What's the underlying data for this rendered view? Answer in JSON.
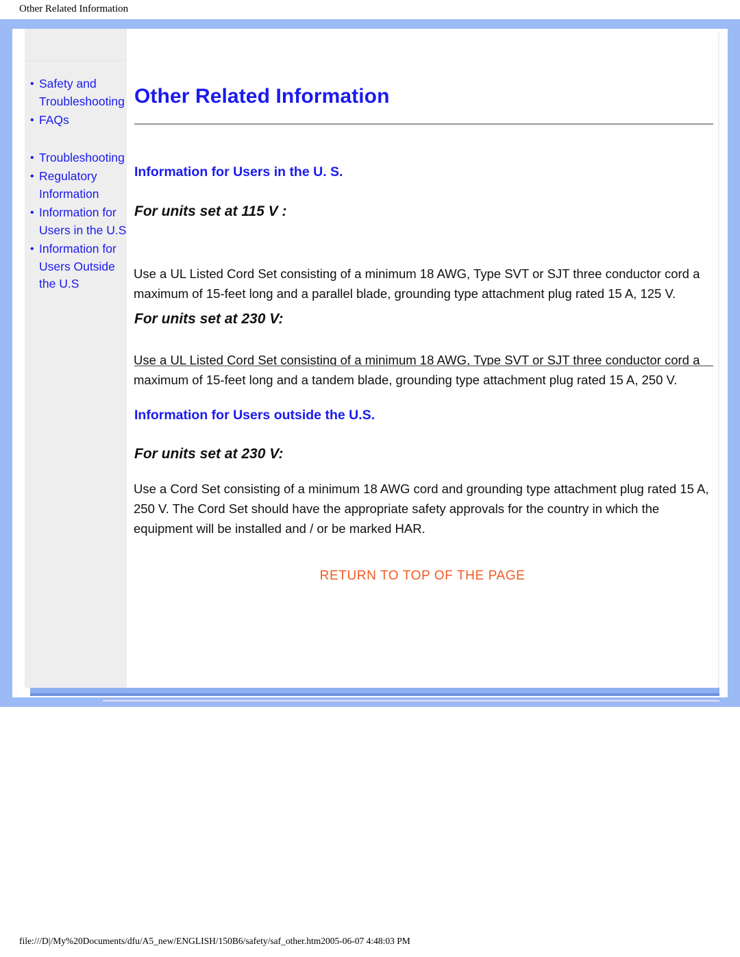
{
  "print_header": {
    "title": "Other Related Information"
  },
  "sidebar": {
    "groups": [
      {
        "items": [
          {
            "label": "Safety and Troubleshooting",
            "name": "sidebar-item-safety-and-troubleshooting"
          },
          {
            "label": "FAQs",
            "name": "sidebar-item-faqs"
          }
        ]
      },
      {
        "items": [
          {
            "label": "Troubleshooting",
            "name": "sidebar-item-troubleshooting"
          },
          {
            "label": "Regulatory Information",
            "name": "sidebar-item-regulatory-information"
          },
          {
            "label": "Information for Users in the U.S",
            "name": "sidebar-item-information-for-users-in-the-us"
          },
          {
            "label": "Information for Users Outside the U.S",
            "name": "sidebar-item-information-for-users-outside-the-us"
          }
        ]
      }
    ]
  },
  "main": {
    "page_title": "Other Related Information",
    "sections": [
      {
        "heading": "Information for Users in the U. S.",
        "blocks": [
          {
            "subheading": "For units set at 115 V :",
            "paragraph": "Use a UL Listed Cord Set consisting of a minimum 18 AWG, Type SVT or SJT three conductor cord a maximum of 15-feet long and a parallel blade, grounding type attachment plug rated 15 A, 125 V."
          },
          {
            "subheading": "For units set at 230 V:",
            "paragraph": "Use a UL Listed Cord Set consisting of a minimum 18 AWG, Type SVT or SJT three conductor cord a maximum of 15-feet long and a tandem blade, grounding type attachment plug rated 15 A, 250 V."
          }
        ]
      },
      {
        "heading": "Information for Users outside the U.S.",
        "blocks": [
          {
            "subheading": "For units set at 230 V:",
            "paragraph": "Use a Cord Set consisting of a minimum 18 AWG cord and grounding type attachment plug rated 15 A, 250 V. The Cord Set should have the appropriate safety approvals for the country in which the equipment will be installed and / or be marked HAR."
          }
        ]
      }
    ],
    "return_link": "RETURN TO TOP OF THE PAGE"
  },
  "footer": {
    "path": "file:///D|/My%20Documents/dfu/A5_new/ENGLISH/150B6/safety/saf_other.htm2005-06-07 4:48:03 PM"
  },
  "colors": {
    "frame_blue": "#9cbaf5",
    "link_blue": "#1a1aee",
    "accent_orange": "#f15a22",
    "sidebar_grey": "#eeeeee",
    "rule_grey": "#9e9e9e"
  }
}
